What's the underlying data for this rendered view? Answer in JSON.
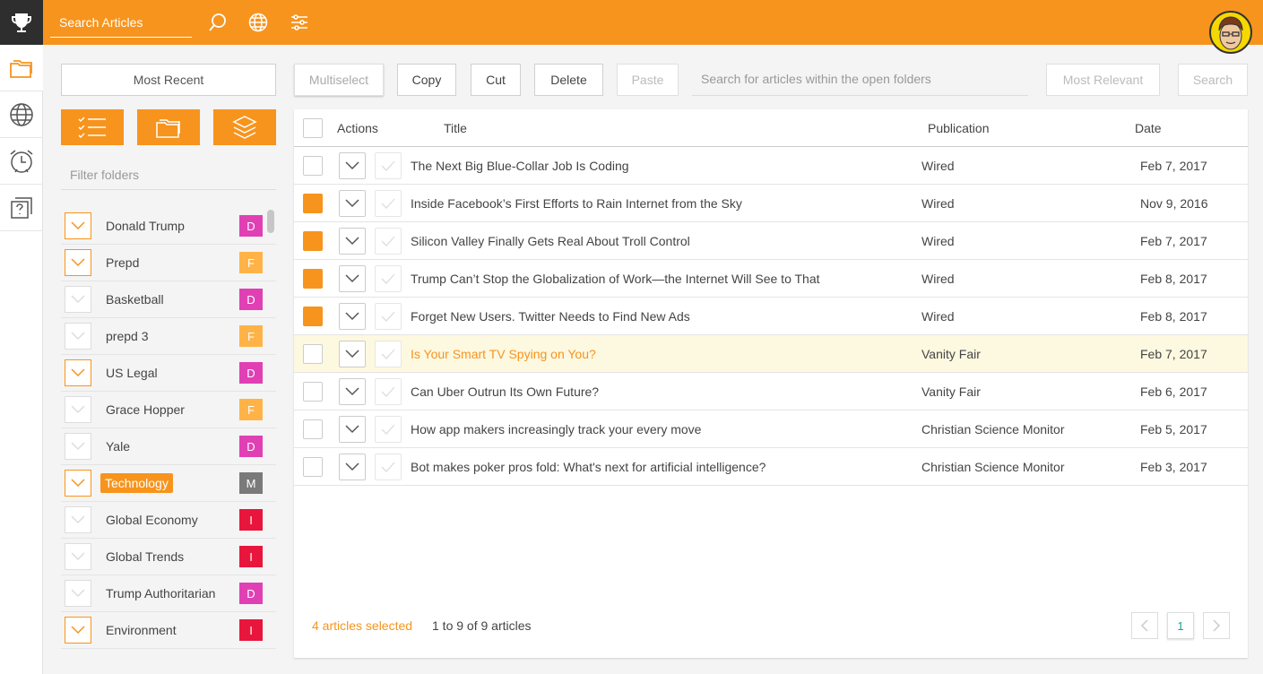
{
  "topbar": {
    "search_label": "Search Articles"
  },
  "sidebar": {
    "most_recent": "Most Recent",
    "filter_placeholder": "Filter folders",
    "folders": [
      {
        "name": "Donald Trump",
        "badge": "D",
        "badge_color": "#e040b4",
        "open": true,
        "highlight": false
      },
      {
        "name": "Prepd",
        "badge": "F",
        "badge_color": "#ffb347",
        "open": true,
        "highlight": false
      },
      {
        "name": "Basketball",
        "badge": "D",
        "badge_color": "#e040b4",
        "open": false,
        "highlight": false
      },
      {
        "name": "prepd 3",
        "badge": "F",
        "badge_color": "#ffb347",
        "open": false,
        "highlight": false
      },
      {
        "name": "US Legal",
        "badge": "D",
        "badge_color": "#e040b4",
        "open": true,
        "highlight": false
      },
      {
        "name": "Grace Hopper",
        "badge": "F",
        "badge_color": "#ffb347",
        "open": false,
        "highlight": false
      },
      {
        "name": "Yale",
        "badge": "D",
        "badge_color": "#e040b4",
        "open": false,
        "highlight": false
      },
      {
        "name": "Technology",
        "badge": "M",
        "badge_color": "#7a7a7a",
        "open": true,
        "highlight": true
      },
      {
        "name": "Global Economy",
        "badge": "I",
        "badge_color": "#e8163c",
        "open": false,
        "highlight": false
      },
      {
        "name": "Global Trends",
        "badge": "I",
        "badge_color": "#e8163c",
        "open": false,
        "highlight": false
      },
      {
        "name": "Trump Authoritarian",
        "badge": "D",
        "badge_color": "#e040b4",
        "open": false,
        "highlight": false
      },
      {
        "name": "Environment",
        "badge": "I",
        "badge_color": "#e8163c",
        "open": true,
        "highlight": false
      }
    ]
  },
  "toolbar": {
    "multiselect": "Multiselect",
    "copy": "Copy",
    "cut": "Cut",
    "delete": "Delete",
    "paste": "Paste",
    "search_within_placeholder": "Search for articles within the open folders",
    "most_relevant": "Most Relevant",
    "search": "Search"
  },
  "table": {
    "headers": {
      "actions": "Actions",
      "title": "Title",
      "publication": "Publication",
      "date": "Date"
    },
    "rows": [
      {
        "title": "The Next Big Blue-Collar Job Is Coding",
        "publication": "Wired",
        "date": "Feb 7, 2017",
        "selected": false,
        "highlight": false
      },
      {
        "title": "Inside Facebook’s First Efforts to Rain Internet from the Sky",
        "publication": "Wired",
        "date": "Nov 9, 2016",
        "selected": true,
        "highlight": false
      },
      {
        "title": "Silicon Valley Finally Gets Real About Troll Control",
        "publication": "Wired",
        "date": "Feb 7, 2017",
        "selected": true,
        "highlight": false
      },
      {
        "title": "Trump Can’t Stop the Globalization of Work—the Internet Will See to That",
        "publication": "Wired",
        "date": "Feb 8, 2017",
        "selected": true,
        "highlight": false
      },
      {
        "title": "Forget New Users. Twitter Needs to Find New Ads",
        "publication": "Wired",
        "date": "Feb 8, 2017",
        "selected": true,
        "highlight": false
      },
      {
        "title": "Is Your Smart TV Spying on You?",
        "publication": "Vanity Fair",
        "date": "Feb 7, 2017",
        "selected": false,
        "highlight": true
      },
      {
        "title": "Can Uber Outrun Its Own Future?",
        "publication": "Vanity Fair",
        "date": "Feb 6, 2017",
        "selected": false,
        "highlight": false
      },
      {
        "title": "How app makers increasingly track your every move",
        "publication": "Christian Science Monitor",
        "date": "Feb 5, 2017",
        "selected": false,
        "highlight": false
      },
      {
        "title": "Bot makes poker pros fold: What's next for artificial intelligence?",
        "publication": "Christian Science Monitor",
        "date": "Feb 3, 2017",
        "selected": false,
        "highlight": false
      }
    ]
  },
  "footer": {
    "selected_text": "4 articles selected",
    "count_text": "1 to 9 of 9 articles",
    "current_page": "1"
  },
  "colors": {
    "accent": "#f7941d",
    "page_current": "#1aa394"
  }
}
